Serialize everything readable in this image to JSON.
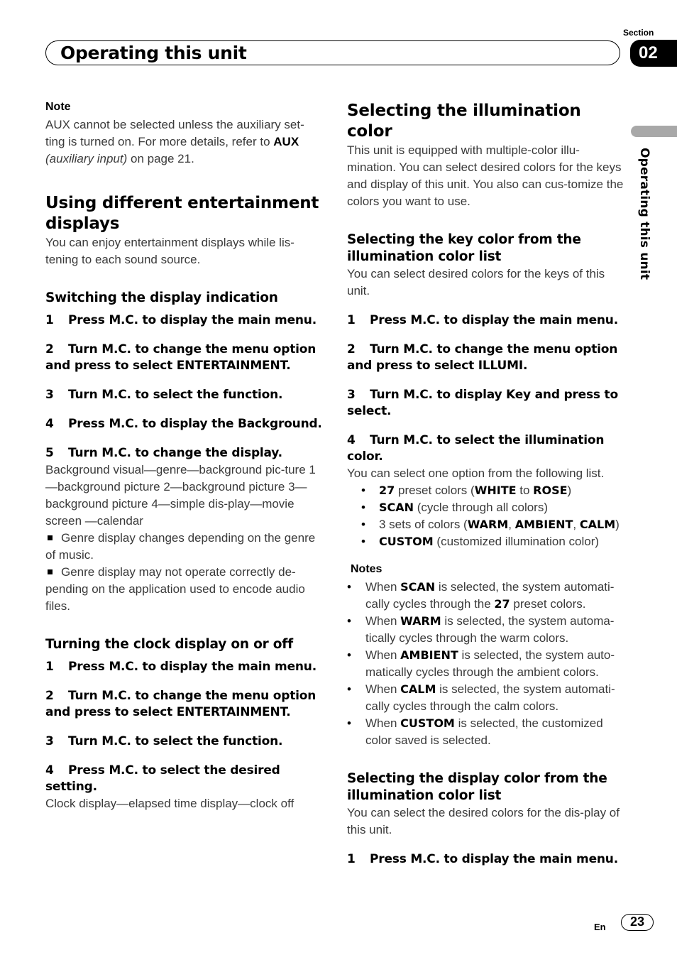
{
  "header": {
    "title": "Operating this unit",
    "section_label": "Section",
    "section_number": "02"
  },
  "side_tab": {
    "text": "Operating this unit"
  },
  "left": {
    "note": {
      "heading": "Note",
      "text_1": "AUX cannot be selected unless the auxiliary set-ting is turned on. For more details, refer to ",
      "bold": "AUX",
      "italic": "(auxiliary input)",
      "text_2": " on page 21."
    },
    "section1": {
      "heading": "Using different entertainment displays",
      "intro": "You can enjoy entertainment displays while lis-tening to each sound source."
    },
    "switching": {
      "heading": "Switching the display indication",
      "steps": [
        {
          "num": "1",
          "text": "Press M.C. to display the main menu."
        },
        {
          "num": "2",
          "text": "Turn M.C. to change the menu option and press to select ENTERTAINMENT."
        },
        {
          "num": "3",
          "text": "Turn M.C. to select the function."
        },
        {
          "num": "4",
          "text": "Press M.C. to display the Background."
        },
        {
          "num": "5",
          "text": "Turn M.C. to change the display."
        }
      ],
      "sequence": "Background visual—genre—background pic-ture 1—background picture 2—background picture 3—background picture 4—simple dis-play—movie screen —calendar",
      "bullets": [
        "Genre display changes depending on the genre of music.",
        "Genre display may not operate correctly de-pending on the application used to encode audio files."
      ]
    },
    "clock": {
      "heading": "Turning the clock display on or off",
      "steps": [
        {
          "num": "1",
          "text": "Press M.C. to display the main menu."
        },
        {
          "num": "2",
          "text": "Turn M.C. to change the menu option and press to select ENTERTAINMENT."
        },
        {
          "num": "3",
          "text": "Turn M.C. to select the function."
        },
        {
          "num": "4",
          "text": "Press M.C. to select the desired setting."
        }
      ],
      "sequence": "Clock display—elapsed time display—clock off"
    }
  },
  "right": {
    "section": {
      "heading": "Selecting the illumination color",
      "intro": "This unit is equipped with multiple-color illu-mination. You can select desired colors for the keys and display of this unit. You also can cus-tomize the colors you want to use."
    },
    "key_color": {
      "heading": "Selecting the key color from the illumination color list",
      "intro": "You can select desired colors for the keys of this unit.",
      "steps": [
        {
          "num": "1",
          "text": "Press M.C. to display the main menu."
        },
        {
          "num": "2",
          "text": "Turn M.C. to change the menu option and press to select ILLUMI."
        },
        {
          "num": "3",
          "text": "Turn M.C. to display Key and press to select."
        },
        {
          "num": "4",
          "text": "Turn M.C. to select the illumination color."
        }
      ],
      "options_intro": "You can select one option from the following list.",
      "options": {
        "o1": {
          "b1": "27",
          "t1": " preset colors (",
          "b2": "WHITE",
          "t2": " to ",
          "b3": "ROSE",
          "t3": ")"
        },
        "o2": {
          "b1": "SCAN",
          "t1": " (cycle through all colors)"
        },
        "o3": {
          "t0": "3 sets of colors (",
          "b1": "WARM",
          "t1": ", ",
          "b2": "AMBIENT",
          "t2": ", ",
          "b3": "CALM",
          "t3": ")"
        },
        "o4": {
          "b1": "CUSTOM",
          "t1": " (customized illumination color)"
        }
      },
      "notes_heading": "Notes",
      "notes": [
        {
          "pre": "When ",
          "bold": "SCAN",
          "post": " is selected, the system automati-cally cycles through the ",
          "bold2": "27",
          "post2": " preset colors."
        },
        {
          "pre": "When ",
          "bold": "WARM",
          "post": " is selected, the system automa-tically cycles through the warm colors."
        },
        {
          "pre": "When ",
          "bold": "AMBIENT",
          "post": " is selected, the system auto-matically cycles through the ambient colors."
        },
        {
          "pre": "When ",
          "bold": "CALM",
          "post": " is selected, the system automati-cally cycles through the calm colors."
        },
        {
          "pre": "When ",
          "bold": "CUSTOM",
          "post": " is selected, the customized color saved is selected."
        }
      ]
    },
    "display_color": {
      "heading": "Selecting the display color from the illumination color list",
      "intro": "You can select the desired colors for the dis-play of this unit.",
      "steps": [
        {
          "num": "1",
          "text": "Press M.C. to display the main menu."
        }
      ]
    }
  },
  "footer": {
    "lang": "En",
    "page": "23"
  }
}
